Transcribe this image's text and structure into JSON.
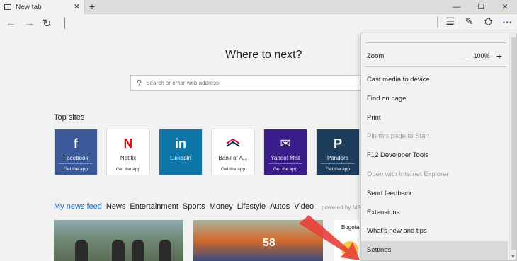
{
  "tab": {
    "title": "New tab",
    "close": "✕",
    "new": "+"
  },
  "window_controls": {
    "minimize": "—",
    "maximize": "☐",
    "close": "✕"
  },
  "nav": {
    "back": "←",
    "forward": "→",
    "refresh": "↻",
    "hub": "☰",
    "note": "✎",
    "share": "⛭",
    "more": "···"
  },
  "main": {
    "heading": "Where to next?",
    "search_placeholder": "Search or enter web address",
    "top_sites_title": "Top sites",
    "tiles": [
      {
        "logo": "f",
        "name": "Facebook",
        "get": "Get the app",
        "bg": "#3b5998",
        "fg": "#ffffff"
      },
      {
        "logo": "N",
        "name": "Netflix",
        "get": "Get the app",
        "bg": "#ffffff",
        "fg": "#222222",
        "logo_color": "#e50914"
      },
      {
        "logo": "in",
        "name": "Linkedin",
        "get": "",
        "bg": "#0e76a8",
        "fg": "#ffffff"
      },
      {
        "logo": "",
        "name": "Bank of A...",
        "get": "Get the app",
        "bg": "#ffffff",
        "fg": "#222222"
      },
      {
        "logo": "✉",
        "name": "Yahoo! Mail",
        "get": "Get the app",
        "bg": "#3a1d8a",
        "fg": "#ffffff"
      },
      {
        "logo": "P",
        "name": "Pandora",
        "get": "Get the app",
        "bg": "#1d3d5c",
        "fg": "#ffffff"
      }
    ],
    "news_tabs": [
      "My news feed",
      "News",
      "Entertainment",
      "Sports",
      "Money",
      "Lifestyle",
      "Autos",
      "Video"
    ],
    "powered_by": "powered by MS",
    "news_number": "58",
    "weather_city": "Bogota"
  },
  "menu": {
    "zoom_label": "Zoom",
    "zoom_minus": "—",
    "zoom_value": "100%",
    "zoom_plus": "+",
    "items": [
      {
        "label": "Cast media to device",
        "disabled": false
      },
      {
        "label": "Find on page",
        "disabled": false
      },
      {
        "label": "Print",
        "disabled": false
      },
      {
        "label": "Pin this page to Start",
        "disabled": true
      },
      {
        "label": "F12 Developer Tools",
        "disabled": false
      },
      {
        "label": "Open with Internet Explorer",
        "disabled": true
      },
      {
        "label": "Send feedback",
        "disabled": false
      },
      {
        "label": "Extensions",
        "disabled": false
      },
      {
        "label": "What's new and tips",
        "disabled": false
      },
      {
        "label": "Settings",
        "disabled": false
      }
    ]
  },
  "colors": {
    "accent": "#1a6fc9",
    "arrow": "#e8403a"
  }
}
